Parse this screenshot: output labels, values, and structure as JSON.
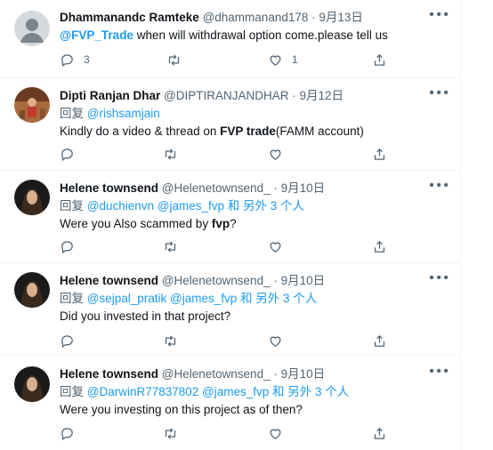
{
  "tweets": [
    {
      "name": "Dhammanandc Ramteke",
      "handle": "@dhammanand178",
      "dot": "·",
      "date": "9月13日",
      "mention": "@FVP_Trade",
      "text": " when will withdrawal option come.please tell us",
      "reply_count": "3",
      "like_count": "1"
    },
    {
      "name": "Dipti Ranjan Dhar",
      "handle": "@DIPTIRANJANDHAR",
      "dot": "·",
      "date": "9月12日",
      "reply_prefix": "回复 ",
      "reply_to": "@rishsamjain",
      "text_a": "Kindly do a video & thread on ",
      "text_b": "FVP trade",
      "text_c": "(FAMM account)"
    },
    {
      "name": "Helene townsend",
      "handle": "@Helenetownsend_",
      "dot": "·",
      "date": "9月10日",
      "reply_prefix": "回复 ",
      "reply_to": "@duchienvn @james_fvp 和 另外 3 个人",
      "text_a": "Were you Also scammed by ",
      "text_b": "fvp",
      "text_c": "?"
    },
    {
      "name": "Helene townsend",
      "handle": "@Helenetownsend_",
      "dot": "·",
      "date": "9月10日",
      "reply_prefix": "回复 ",
      "reply_to": "@sejpal_pratik @james_fvp 和 另外 3 个人",
      "text": "Did you invested in that project?"
    },
    {
      "name": "Helene townsend",
      "handle": "@Helenetownsend_",
      "dot": "·",
      "date": "9月10日",
      "reply_prefix": "回复 ",
      "reply_to": "@DarwinR77837802 @james_fvp 和 另外 3 个人",
      "text": "Were you investing on this project as of then?"
    }
  ],
  "icons": {
    "reply": "reply-icon",
    "retweet": "retweet-icon",
    "like": "like-icon",
    "share": "share-icon",
    "more": "more-icon"
  },
  "colors": {
    "link": "#1d9bf0",
    "secondary": "#536471",
    "primary_text": "#0f1419"
  }
}
